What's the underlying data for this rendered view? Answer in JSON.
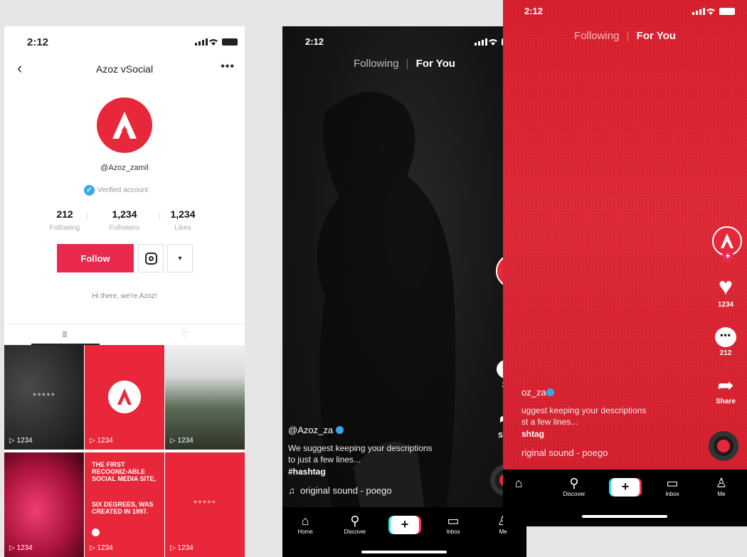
{
  "status_time": "2:12",
  "profile": {
    "title": "Azoz vSocial",
    "back_glyph": "‹",
    "more_glyph": "•••",
    "handle": "@Azoz_zamil",
    "verified_text": "Verified account",
    "stats": [
      {
        "value": "212",
        "label": "Following"
      },
      {
        "value": "1,234",
        "label": "Followers"
      },
      {
        "value": "1,234",
        "label": "Likes"
      }
    ],
    "follow_label": "Follow",
    "bio": "Hi there, we're Azoz!",
    "grid_count": "▷ 1234",
    "grid_text_1": "THE FIRST RECOGNIZ-ABLE SOCIAL MEDIA SITE,",
    "grid_text_2": "SIX DEGREES, WAS CREATED IN 1997.",
    "grid_placeholder": "●●●●●"
  },
  "feed": {
    "tab_following": "Following",
    "tab_foryou": "For You",
    "likes": "1234",
    "comments": "212",
    "share": "Share",
    "username": "@Azoz_za",
    "username_cropped": "oz_za",
    "description_line1": "We suggest keeping your descriptions",
    "description_line2": "to just a few lines...",
    "description_line1_cropped": "uggest keeping your descriptions",
    "description_line2_cropped": "st a few lines...",
    "hashtag": "#hashtag",
    "hashtag_cropped": "shtag",
    "sound": "original sound - poego",
    "sound_cropped": "riginal sound - poego",
    "tabbar": {
      "home": "Home",
      "discover": "Discover",
      "inbox": "Inbox",
      "me": "Me"
    }
  },
  "colors": {
    "brand_red": "#e8283a",
    "follow_pink": "#e8284d",
    "verified_blue": "#38a7e8"
  }
}
